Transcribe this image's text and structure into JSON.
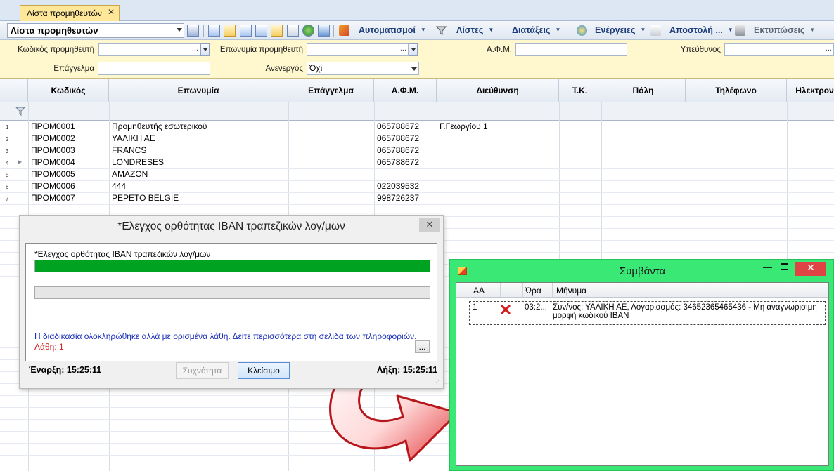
{
  "tab": {
    "title": "Λίστα προμηθευτών",
    "close": "✕"
  },
  "toolbar": {
    "list_combo": "Λίστα προμηθευτών",
    "menus": [
      {
        "label": "Αυτοματισμοί",
        "icon": "automation-icon"
      },
      {
        "label": "Λίστες",
        "icon": "filter-icon"
      },
      {
        "label": "Διατάξεις",
        "icon": ""
      },
      {
        "label": "Ενέργειες",
        "icon": "actions-icon"
      },
      {
        "label": "Αποστολή ...",
        "icon": "send-icon"
      },
      {
        "label": "Εκτυπώσεις",
        "icon": "printer-icon"
      }
    ]
  },
  "filters": {
    "code_label": "Κωδικός προμηθευτή",
    "name_label": "Επωνυμία προμηθευτή",
    "afm_label": "Α.Φ.Μ.",
    "responsible_label": "Υπεύθυνος",
    "profession_label": "Επάγγελμα",
    "inactive_label": "Ανενεργός",
    "inactive_value": "Όχι",
    "ellipsis": "..."
  },
  "grid": {
    "columns": [
      "Κωδικός",
      "Επωνυμία",
      "Επάγγελμα",
      "Α.Φ.Μ.",
      "Διεύθυνση",
      "Τ.Κ.",
      "Πόλη",
      "Τηλέφωνο",
      "Ηλεκτρον"
    ],
    "rows": [
      {
        "num": "1",
        "code": "ΠΡΟΜ0001",
        "name": "Προμηθευτής εσωτερικού",
        "afm": "065788672",
        "address": "Γ.Γεωργίου 1"
      },
      {
        "num": "2",
        "code": "ΠΡΟΜ0002",
        "name": "ΥΑΛΙΚΗ ΑΕ",
        "afm": "065788672",
        "address": ""
      },
      {
        "num": "3",
        "code": "ΠΡΟΜ0003",
        "name": "FRANCS",
        "afm": "065788672",
        "address": ""
      },
      {
        "num": "4",
        "code": "ΠΡΟΜ0004",
        "name": "LONDRESES",
        "afm": "065788672",
        "address": ""
      },
      {
        "num": "5",
        "code": "ΠΡΟΜ0005",
        "name": "AMAZON",
        "afm": "",
        "address": ""
      },
      {
        "num": "6",
        "code": "ΠΡΟΜ0006",
        "name": "444",
        "afm": "022039532",
        "address": ""
      },
      {
        "num": "7",
        "code": "ΠΡΟΜ0007",
        "name": "PEPETO BELGIE",
        "afm": "998726237",
        "address": ""
      }
    ]
  },
  "progress_dialog": {
    "title": "*Ελεγχος ορθότητας IBAN τραπεζικών λογ/μων",
    "close": "✕",
    "task_label": "*Ελεγχος ορθότητας IBAN τραπεζικών λογ/μων",
    "progress_main": 1.0,
    "progress_secondary": 0.0,
    "message": "Η διαδικασία ολοκληρώθηκε αλλά με ορισμένα λάθη. Δείτε περισσότερα στη σελίδα των πληροφοριών.",
    "errors": "Λάθη: 1",
    "details_button": "...",
    "start_label": "Έναρξη:",
    "start_time": "15:25:11",
    "end_label": "Λήξη:",
    "end_time": "15:25:11",
    "frequency_button": "Συχνότητα",
    "close_button": "Κλείσιμο",
    "colors": {
      "progress": "#00a321",
      "message": "#1a2fb8",
      "error": "#d42020"
    }
  },
  "events_window": {
    "title": "Συμβάντα",
    "columns": [
      "AA",
      "",
      "Ώρα",
      "Μήνυμα"
    ],
    "rows": [
      {
        "aa": "1",
        "icon": "error-icon",
        "time": "03:2...",
        "message": "Συν/νος: ΥΑΛΙΚΗ ΑΕ, Λογαριασμός: 34652365465436 -  Μη αναγνωρισιμη μορφή κωδικού IBAN"
      }
    ],
    "colors": {
      "frame": "#3ae875",
      "close": "#e04343"
    }
  }
}
